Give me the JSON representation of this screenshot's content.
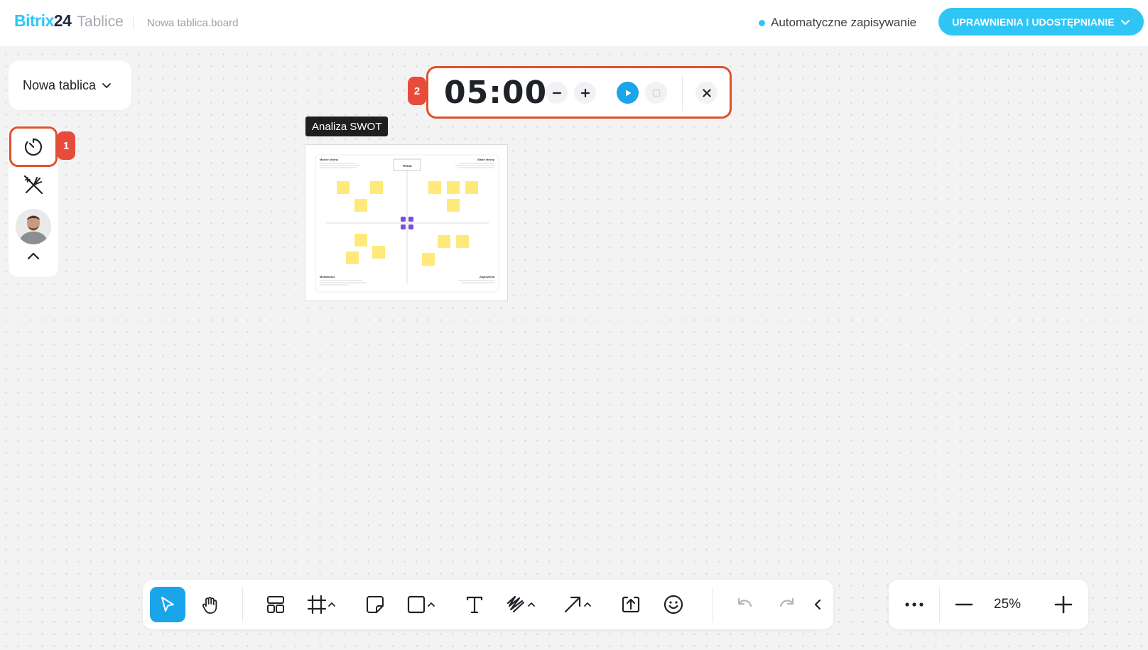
{
  "header": {
    "brand": "Bitrix",
    "brand_number": "24",
    "app_name": "Tablice",
    "file_name": "Nowa tablica.board",
    "autosave_label": "Automatyczne zapisywanie",
    "share_button_label": "UPRAWNIENIA I UDOSTĘPNIANIE"
  },
  "board_selector": {
    "label": "Nowa tablica"
  },
  "left_panel": {
    "tools": [
      {
        "name": "timer-icon"
      },
      {
        "name": "laser-off-icon"
      },
      {
        "name": "user-avatar"
      },
      {
        "name": "chevron-up-icon"
      }
    ]
  },
  "annotations": {
    "badge_1": "1",
    "badge_2": "2"
  },
  "timer": {
    "time": "05:00",
    "controls": [
      "minus-icon",
      "plus-icon",
      "play-icon",
      "stop-icon",
      "close-icon"
    ]
  },
  "template": {
    "label": "Analiza SWOT",
    "center_label": "Temat",
    "quadrants": {
      "top_left": "Mocne strony",
      "top_right": "Słabe strony",
      "bottom_left": "Możliwości",
      "bottom_right": "Zagrożenia"
    }
  },
  "toolbar": {
    "tools": [
      "select-icon",
      "hand-icon",
      "layout-icon",
      "frame-icon",
      "sticky-note-icon",
      "shape-icon",
      "text-icon",
      "pen-icon",
      "arrow-icon",
      "upload-icon",
      "emoji-icon",
      "undo-icon",
      "redo-icon",
      "collapse-icon"
    ]
  },
  "zoom": {
    "value": "25%"
  },
  "colors": {
    "accent": "#2fc6f6",
    "active_tool": "#1aa4ea",
    "highlight": "#e0502e",
    "badge": "#e84a3c",
    "sticky": "#ffe97a"
  }
}
